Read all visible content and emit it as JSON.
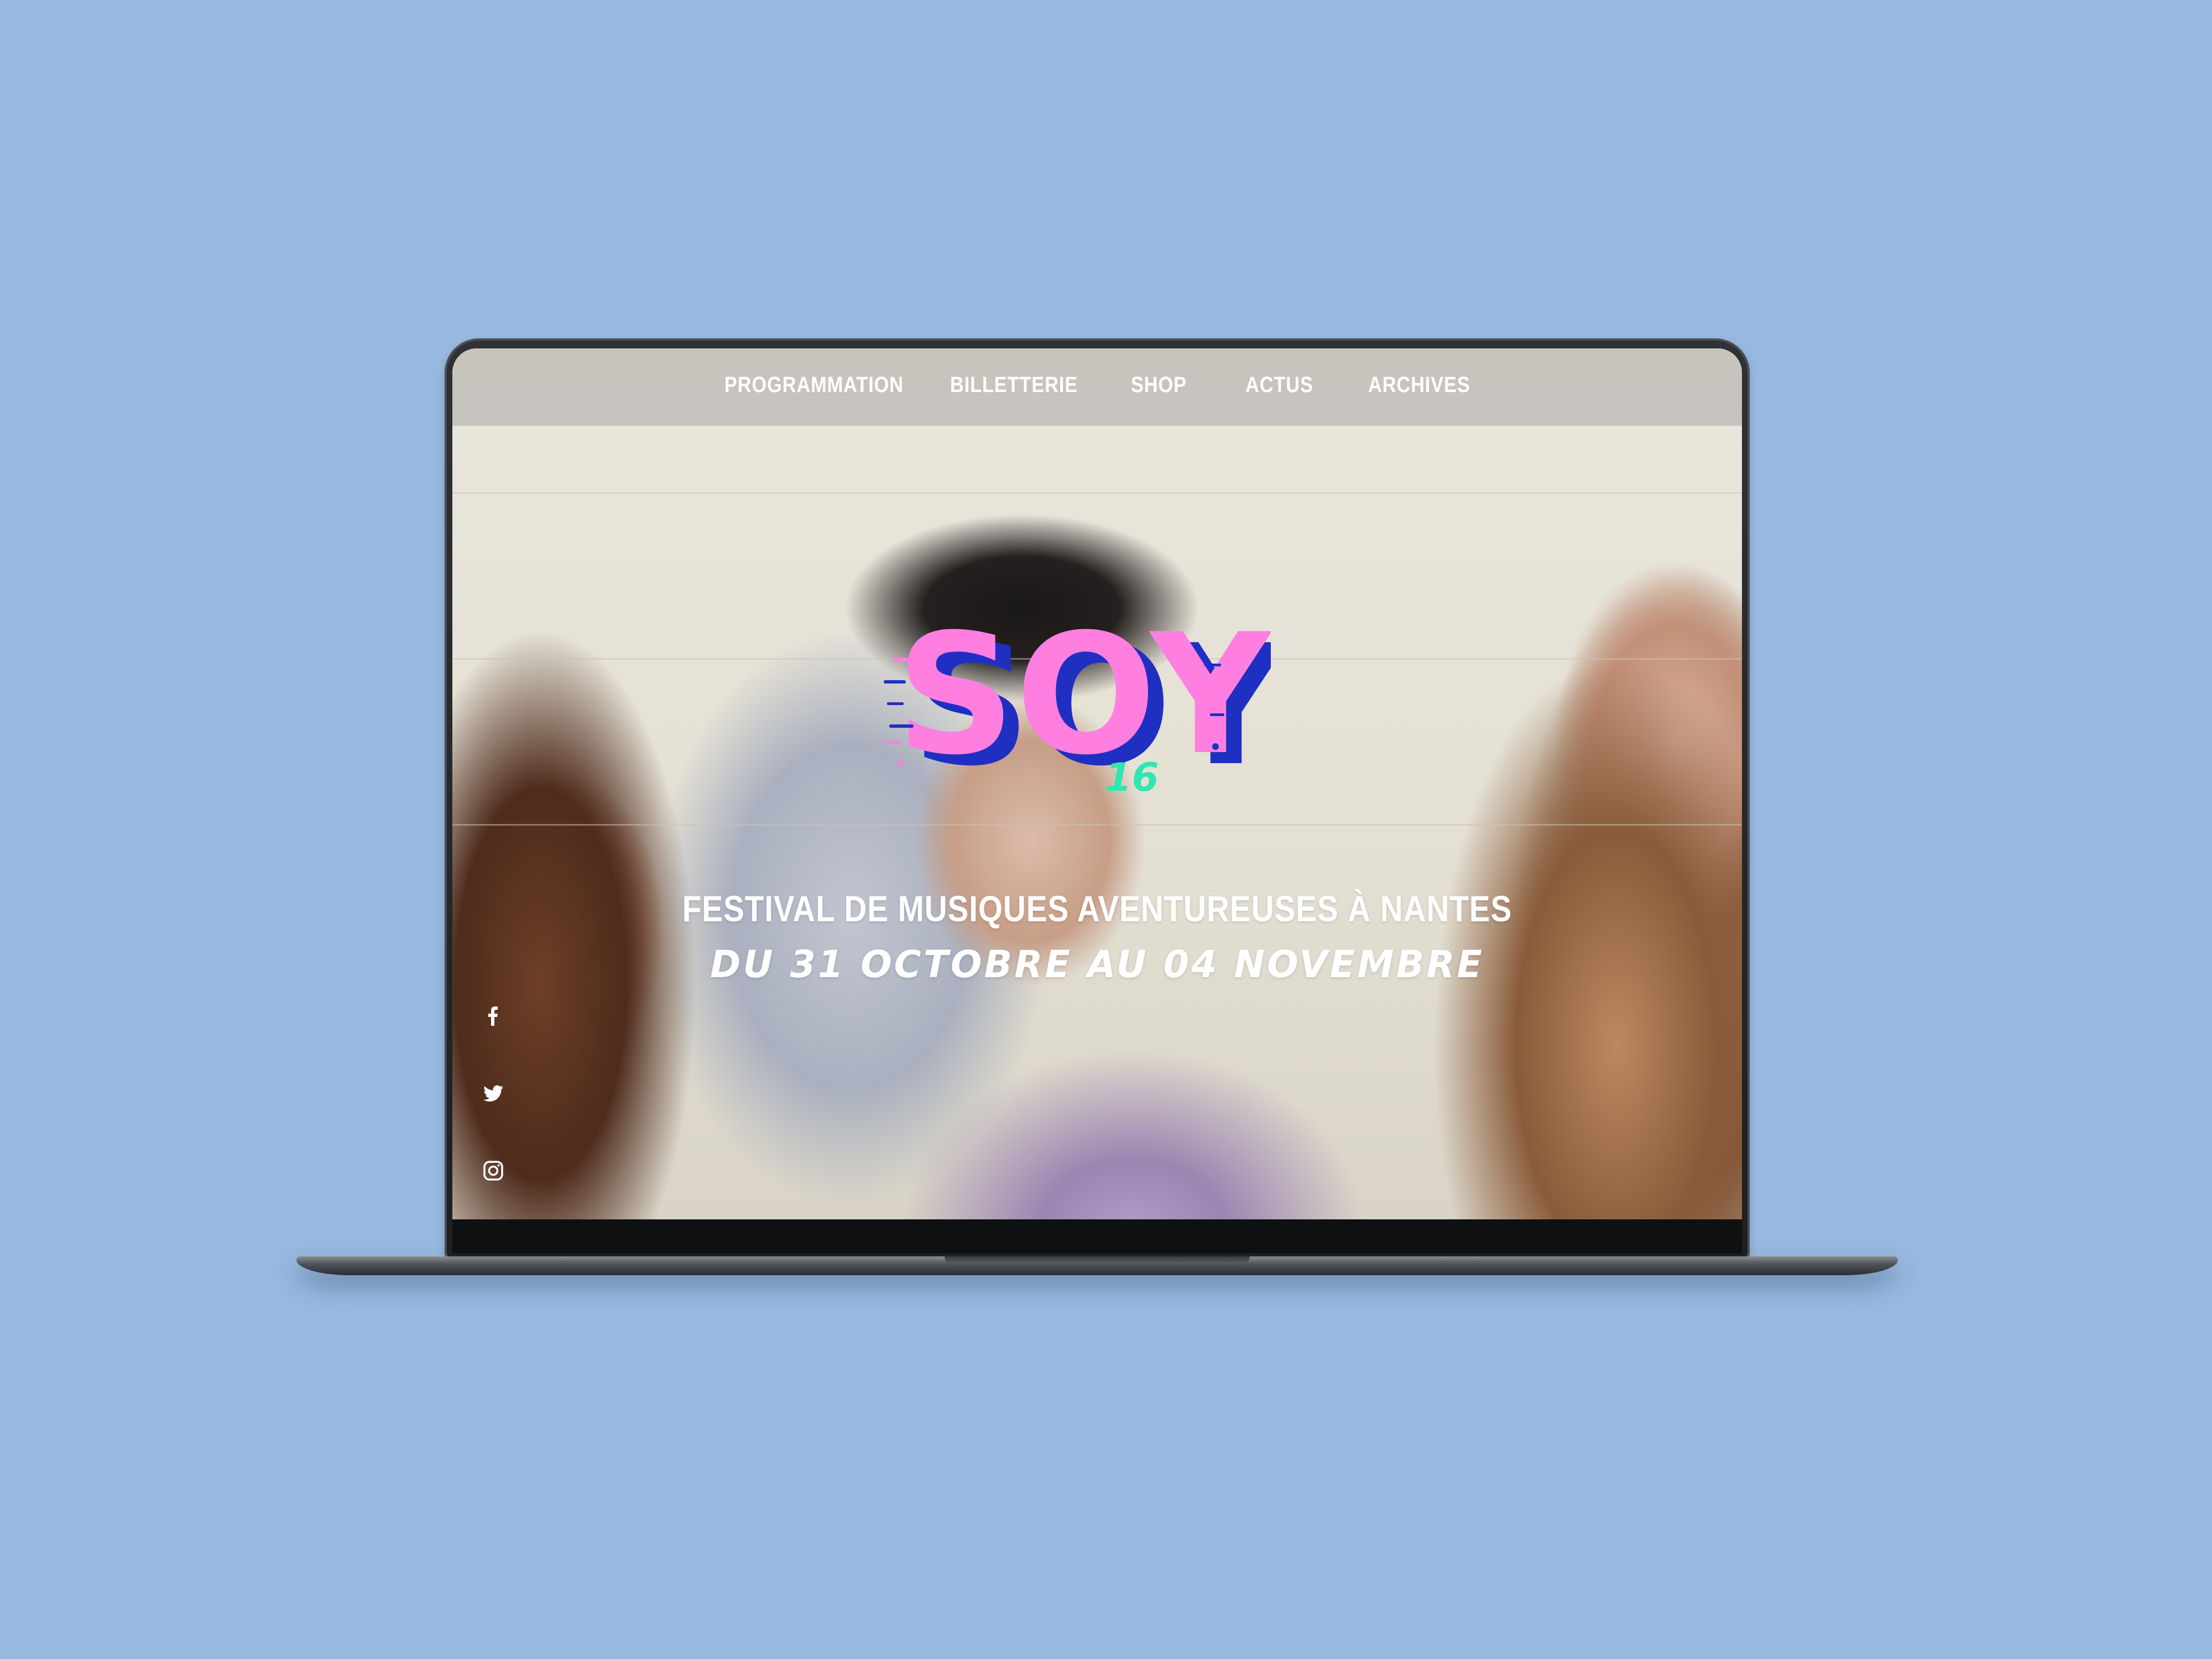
{
  "nav": {
    "items": [
      {
        "label": "PROGRAMMATION"
      },
      {
        "label": "BILLETTERIE"
      },
      {
        "label": "SHOP"
      },
      {
        "label": "ACTUS"
      },
      {
        "label": "ARCHIVES"
      }
    ]
  },
  "logo": {
    "text": "SOY",
    "edition": "16",
    "colors": {
      "pink": "#ff7fe0",
      "blue": "#1f2fc2",
      "green": "#2fe7b0"
    }
  },
  "hero": {
    "tagline": "FESTIVAL DE MUSIQUES AVENTUREUSES À NANTES",
    "dates": "DU 31 OCTOBRE AU 04 NOVEMBRE"
  },
  "social": {
    "icons": [
      "facebook-icon",
      "twitter-icon",
      "instagram-icon"
    ]
  },
  "colors": {
    "page_background": "#97b8df",
    "nav_background": "#c4c1bb",
    "text": "#ffffff"
  }
}
